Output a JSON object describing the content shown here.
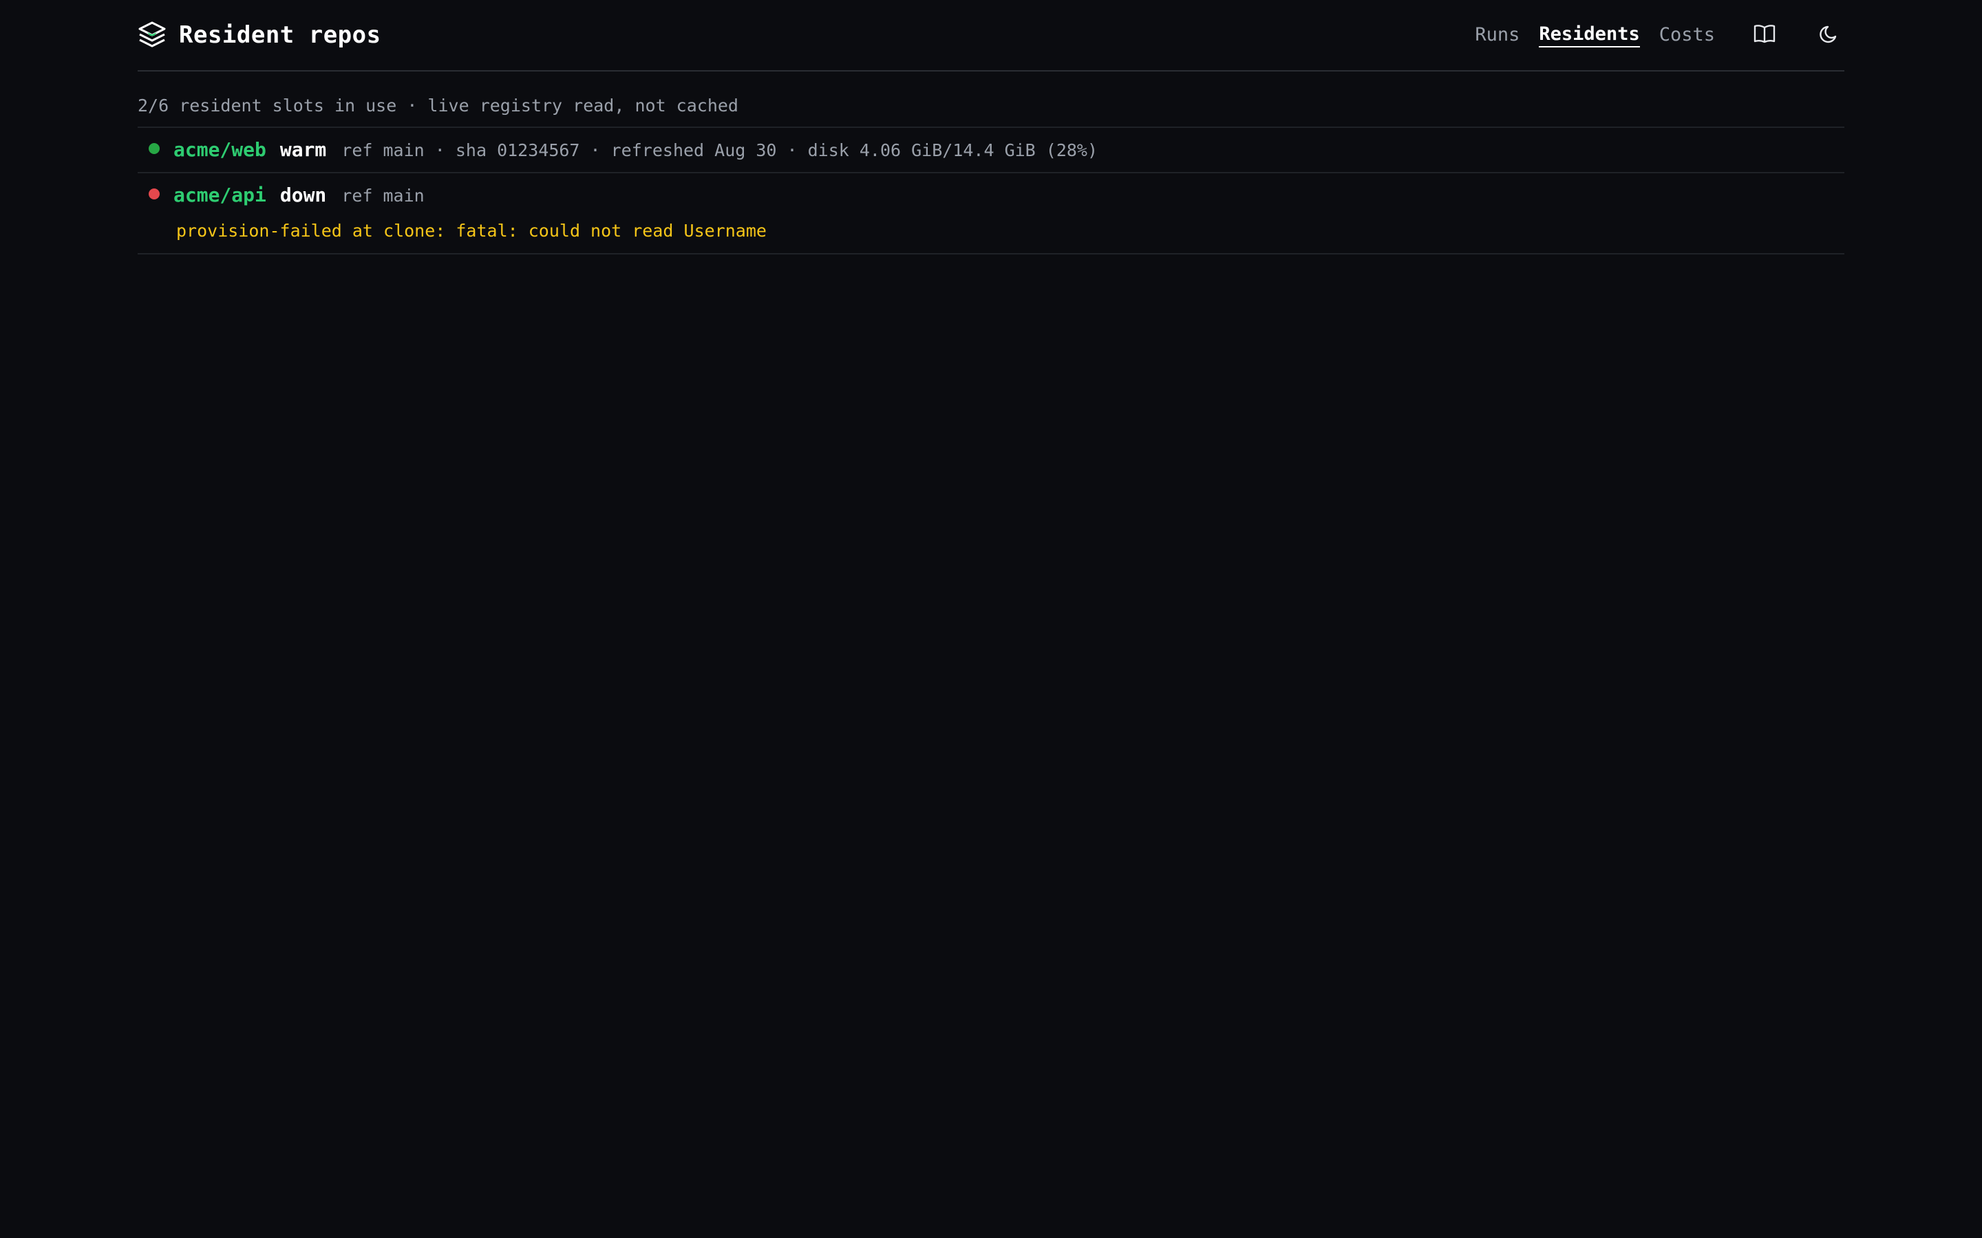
{
  "header": {
    "title": "Resident repos",
    "nav": [
      {
        "label": "Runs",
        "active": false
      },
      {
        "label": "Residents",
        "active": true
      },
      {
        "label": "Costs",
        "active": false
      }
    ],
    "icons": {
      "brand": "layers-icon",
      "docs": "book-open-icon",
      "theme": "moon-icon"
    }
  },
  "summary": "2/6 resident slots in use · live registry read, not cached",
  "residents": [
    {
      "repo": "acme/web",
      "state": "warm",
      "status_color": "#27a745",
      "meta": "ref main · sha 01234567 · refreshed Aug 30 · disk 4.06 GiB/14.4 GiB (28%)",
      "error": ""
    },
    {
      "repo": "acme/api",
      "state": "down",
      "status_color": "#e5484d",
      "meta": "ref main",
      "error": "provision-failed at clone: fatal: could not read Username"
    }
  ],
  "colors": {
    "background": "#0b0c10",
    "accent": "#2ecc71",
    "warning": "#f5c518"
  }
}
